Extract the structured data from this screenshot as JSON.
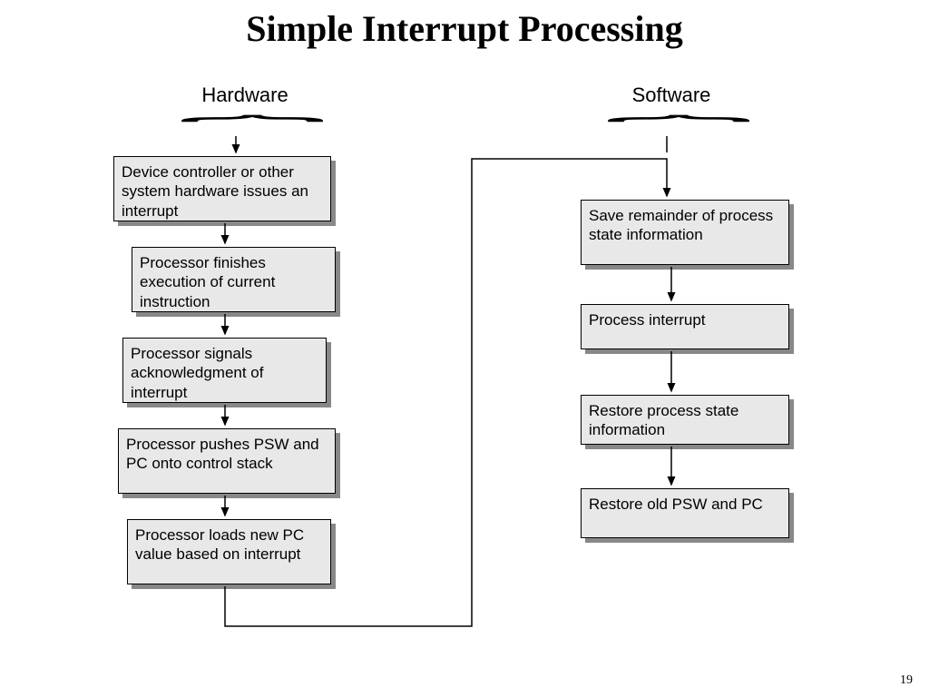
{
  "title": "Simple Interrupt Processing",
  "page_number": "19",
  "columns": {
    "hardware": {
      "label": "Hardware"
    },
    "software": {
      "label": "Software"
    }
  },
  "hardware_steps": [
    "Device controller or other system hardware issues an interrupt",
    "Processor finishes execution of current instruction",
    "Processor signals acknowledgment of interrupt",
    "Processor pushes PSW and PC onto control stack",
    "Processor loads new PC value based on interrupt"
  ],
  "software_steps": [
    "Save remainder of process state information",
    "Process interrupt",
    "Restore process state information",
    "Restore old PSW and PC"
  ]
}
